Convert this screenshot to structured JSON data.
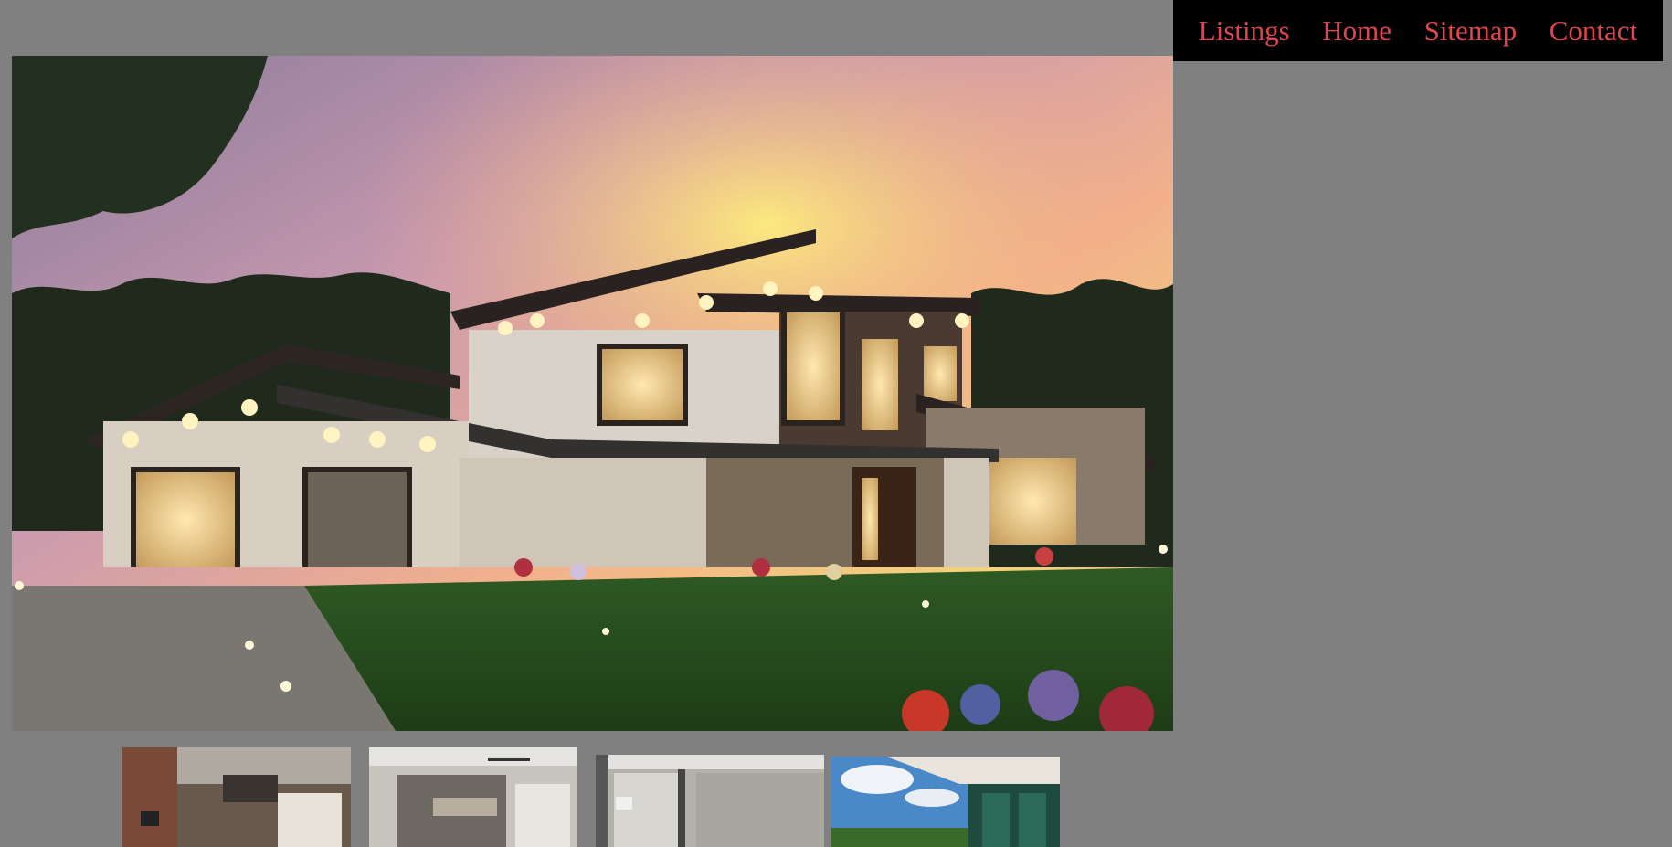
{
  "nav": {
    "items": [
      {
        "label": "Listings"
      },
      {
        "label": "Home"
      },
      {
        "label": "Sitemap"
      },
      {
        "label": "Contact"
      }
    ],
    "link_color": "#e0454f",
    "background": "#000000"
  },
  "page": {
    "background": "#808080"
  },
  "hero": {
    "subject": "modern two-story house at dusk"
  },
  "thumbnails": [
    {
      "subject": "living room with brick wall"
    },
    {
      "subject": "bedroom with ceiling fan"
    },
    {
      "subject": "bathroom interior"
    },
    {
      "subject": "balcony view of sky and trees"
    }
  ]
}
